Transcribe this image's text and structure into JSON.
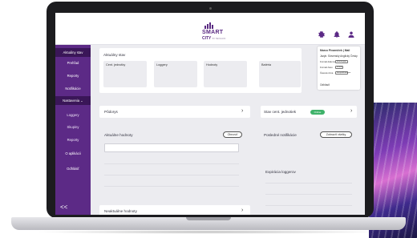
{
  "app": {
    "logo_line1": "SMART",
    "logo_line2": "CITY",
    "logo_tagline": "BY HEXAGON"
  },
  "header": {
    "icons": [
      "gear-icon",
      "bell-icon",
      "user-icon"
    ]
  },
  "sidebar": {
    "items": [
      {
        "label": "Aktuálny stav"
      },
      {
        "label": "Prehľad"
      },
      {
        "label": "Reporty"
      },
      {
        "label": "Notifikácie"
      },
      {
        "label": "Nastavenia"
      },
      {
        "label": "Loggery"
      },
      {
        "label": "Skupiny"
      },
      {
        "label": "Reporty"
      },
      {
        "label": "O aplikácii"
      },
      {
        "label": "Odhlásiť"
      }
    ],
    "collapse_label": "<<"
  },
  "main": {
    "page_title": "Aktuálny stav",
    "kpis": [
      {
        "label": "Cent. jednotky"
      },
      {
        "label": "Loggery"
      },
      {
        "label": "Hodnoty"
      },
      {
        "label": "Batéria"
      }
    ],
    "floor_plan_label": "Pôdorys",
    "current_values_label": "Aktuálne hodnoty",
    "refresh_button": "Obnoviť",
    "unread_values_label": "Neaktuálne hodnoty",
    "central_unit_status_label": "Stav cent. jednotiek",
    "status_badge": "Online",
    "last_notifications_label": "Posledné notifikácie",
    "show_all_button": "Zobraziť všetky",
    "logger_expiration_label": "Expirácia loggerov"
  },
  "user_menu": {
    "name": "Marco Pivarníček | Mail",
    "language": "Jazyk: Slovenský Anglický Česky",
    "rows": [
      {
        "label": "Formát dátumu",
        "value": "dd.mm.yyyy"
      },
      {
        "label": "Formát času",
        "value": "hh:mm"
      },
      {
        "label": "Časová zóna",
        "value": "Europe/Bratislava"
      }
    ],
    "logout": "Odhlásiť"
  }
}
